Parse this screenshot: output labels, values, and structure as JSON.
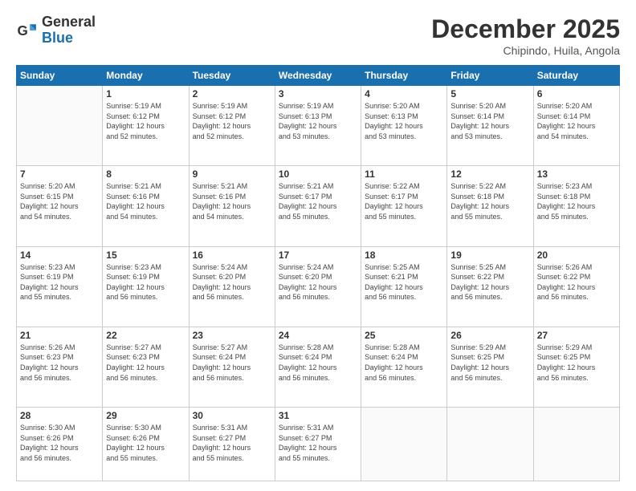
{
  "header": {
    "logo_general": "General",
    "logo_blue": "Blue",
    "month_title": "December 2025",
    "subtitle": "Chipindo, Huila, Angola"
  },
  "days_of_week": [
    "Sunday",
    "Monday",
    "Tuesday",
    "Wednesday",
    "Thursday",
    "Friday",
    "Saturday"
  ],
  "weeks": [
    [
      {
        "day": "",
        "info": ""
      },
      {
        "day": "1",
        "info": "Sunrise: 5:19 AM\nSunset: 6:12 PM\nDaylight: 12 hours\nand 52 minutes."
      },
      {
        "day": "2",
        "info": "Sunrise: 5:19 AM\nSunset: 6:12 PM\nDaylight: 12 hours\nand 52 minutes."
      },
      {
        "day": "3",
        "info": "Sunrise: 5:19 AM\nSunset: 6:13 PM\nDaylight: 12 hours\nand 53 minutes."
      },
      {
        "day": "4",
        "info": "Sunrise: 5:20 AM\nSunset: 6:13 PM\nDaylight: 12 hours\nand 53 minutes."
      },
      {
        "day": "5",
        "info": "Sunrise: 5:20 AM\nSunset: 6:14 PM\nDaylight: 12 hours\nand 53 minutes."
      },
      {
        "day": "6",
        "info": "Sunrise: 5:20 AM\nSunset: 6:14 PM\nDaylight: 12 hours\nand 54 minutes."
      }
    ],
    [
      {
        "day": "7",
        "info": "Sunrise: 5:20 AM\nSunset: 6:15 PM\nDaylight: 12 hours\nand 54 minutes."
      },
      {
        "day": "8",
        "info": "Sunrise: 5:21 AM\nSunset: 6:16 PM\nDaylight: 12 hours\nand 54 minutes."
      },
      {
        "day": "9",
        "info": "Sunrise: 5:21 AM\nSunset: 6:16 PM\nDaylight: 12 hours\nand 54 minutes."
      },
      {
        "day": "10",
        "info": "Sunrise: 5:21 AM\nSunset: 6:17 PM\nDaylight: 12 hours\nand 55 minutes."
      },
      {
        "day": "11",
        "info": "Sunrise: 5:22 AM\nSunset: 6:17 PM\nDaylight: 12 hours\nand 55 minutes."
      },
      {
        "day": "12",
        "info": "Sunrise: 5:22 AM\nSunset: 6:18 PM\nDaylight: 12 hours\nand 55 minutes."
      },
      {
        "day": "13",
        "info": "Sunrise: 5:23 AM\nSunset: 6:18 PM\nDaylight: 12 hours\nand 55 minutes."
      }
    ],
    [
      {
        "day": "14",
        "info": "Sunrise: 5:23 AM\nSunset: 6:19 PM\nDaylight: 12 hours\nand 55 minutes."
      },
      {
        "day": "15",
        "info": "Sunrise: 5:23 AM\nSunset: 6:19 PM\nDaylight: 12 hours\nand 56 minutes."
      },
      {
        "day": "16",
        "info": "Sunrise: 5:24 AM\nSunset: 6:20 PM\nDaylight: 12 hours\nand 56 minutes."
      },
      {
        "day": "17",
        "info": "Sunrise: 5:24 AM\nSunset: 6:20 PM\nDaylight: 12 hours\nand 56 minutes."
      },
      {
        "day": "18",
        "info": "Sunrise: 5:25 AM\nSunset: 6:21 PM\nDaylight: 12 hours\nand 56 minutes."
      },
      {
        "day": "19",
        "info": "Sunrise: 5:25 AM\nSunset: 6:22 PM\nDaylight: 12 hours\nand 56 minutes."
      },
      {
        "day": "20",
        "info": "Sunrise: 5:26 AM\nSunset: 6:22 PM\nDaylight: 12 hours\nand 56 minutes."
      }
    ],
    [
      {
        "day": "21",
        "info": "Sunrise: 5:26 AM\nSunset: 6:23 PM\nDaylight: 12 hours\nand 56 minutes."
      },
      {
        "day": "22",
        "info": "Sunrise: 5:27 AM\nSunset: 6:23 PM\nDaylight: 12 hours\nand 56 minutes."
      },
      {
        "day": "23",
        "info": "Sunrise: 5:27 AM\nSunset: 6:24 PM\nDaylight: 12 hours\nand 56 minutes."
      },
      {
        "day": "24",
        "info": "Sunrise: 5:28 AM\nSunset: 6:24 PM\nDaylight: 12 hours\nand 56 minutes."
      },
      {
        "day": "25",
        "info": "Sunrise: 5:28 AM\nSunset: 6:24 PM\nDaylight: 12 hours\nand 56 minutes."
      },
      {
        "day": "26",
        "info": "Sunrise: 5:29 AM\nSunset: 6:25 PM\nDaylight: 12 hours\nand 56 minutes."
      },
      {
        "day": "27",
        "info": "Sunrise: 5:29 AM\nSunset: 6:25 PM\nDaylight: 12 hours\nand 56 minutes."
      }
    ],
    [
      {
        "day": "28",
        "info": "Sunrise: 5:30 AM\nSunset: 6:26 PM\nDaylight: 12 hours\nand 56 minutes."
      },
      {
        "day": "29",
        "info": "Sunrise: 5:30 AM\nSunset: 6:26 PM\nDaylight: 12 hours\nand 55 minutes."
      },
      {
        "day": "30",
        "info": "Sunrise: 5:31 AM\nSunset: 6:27 PM\nDaylight: 12 hours\nand 55 minutes."
      },
      {
        "day": "31",
        "info": "Sunrise: 5:31 AM\nSunset: 6:27 PM\nDaylight: 12 hours\nand 55 minutes."
      },
      {
        "day": "",
        "info": ""
      },
      {
        "day": "",
        "info": ""
      },
      {
        "day": "",
        "info": ""
      }
    ]
  ]
}
